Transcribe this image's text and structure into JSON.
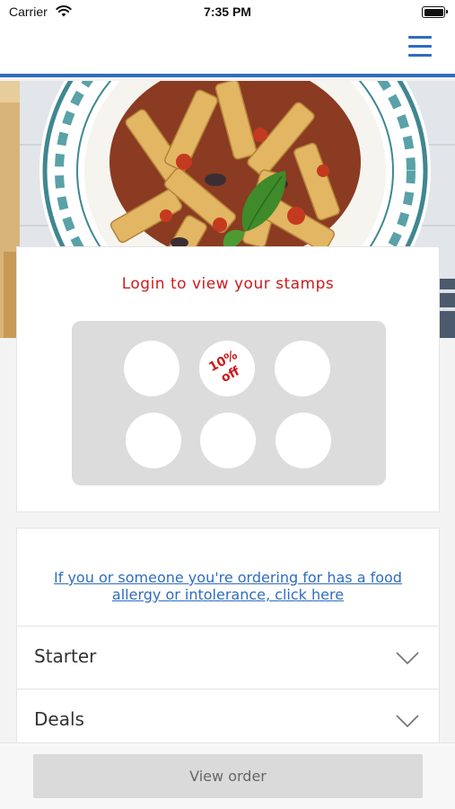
{
  "status_bar": {
    "carrier": "Carrier",
    "time": "7:35 PM"
  },
  "nav": {
    "menu_icon": "hamburger-menu-icon",
    "accent_color": "#2f6dbf"
  },
  "hero": {
    "image": "pasta-dish-photo"
  },
  "loyalty": {
    "login_prompt": "Login to view your stamps",
    "reward_line1": "10%",
    "reward_line2": "off",
    "total_stamps": 6,
    "accent_color": "#cc1b1b"
  },
  "menu": {
    "allergy_link": "If you or someone you're ordering for has a food allergy or intolerance, click here",
    "categories": [
      {
        "label": "Starter",
        "icon": "chevron-down-icon"
      },
      {
        "label": "Deals",
        "icon": "chevron-down-icon"
      }
    ]
  },
  "footer": {
    "view_order_label": "View order"
  }
}
